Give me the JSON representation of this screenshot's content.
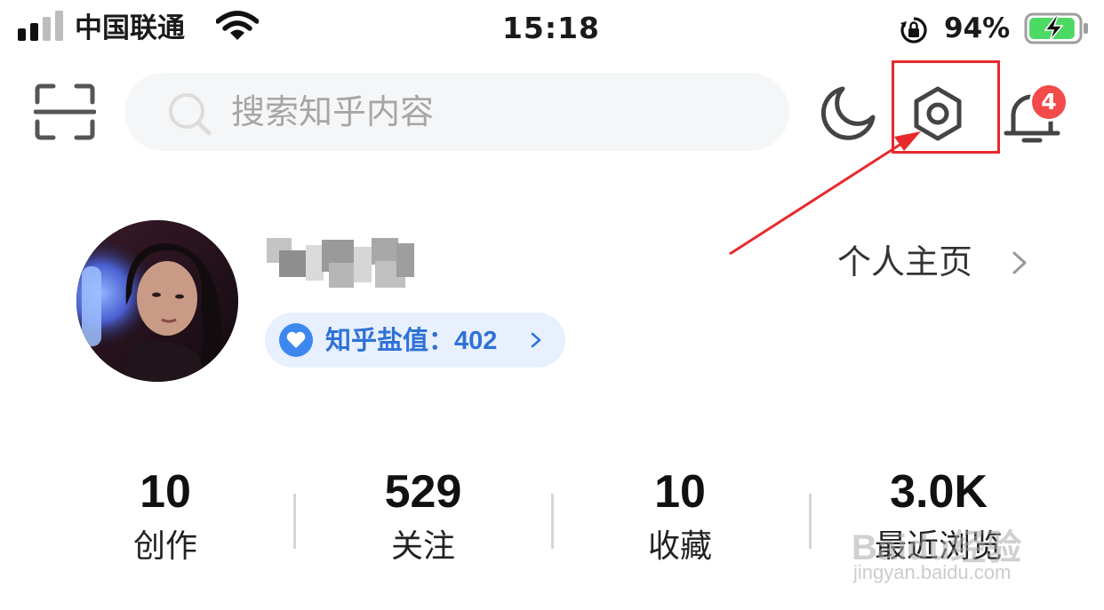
{
  "status_bar": {
    "carrier": "中国联通",
    "time": "15:18",
    "battery_percent": "94%",
    "battery_level": 0.94,
    "icons": [
      "signal-icon",
      "wifi-icon",
      "orientation-lock-icon",
      "battery-charging-icon"
    ]
  },
  "top_bar": {
    "search_placeholder": "搜索知乎内容",
    "icons": [
      "scan-icon",
      "search-icon",
      "night-mode-icon",
      "settings-icon",
      "bell-icon"
    ],
    "notification_count": "4",
    "highlight_color": "#e8292c"
  },
  "profile": {
    "salt_label": "知乎盐值：",
    "salt_value": "402",
    "homepage_label": "个人主页",
    "accent_color": "#2f72d6"
  },
  "stats": [
    {
      "value": "10",
      "label": "创作"
    },
    {
      "value": "529",
      "label": "关注"
    },
    {
      "value": "10",
      "label": "收藏"
    },
    {
      "value": "3.0K",
      "label": "最近浏览"
    }
  ],
  "watermark": {
    "text": "Baidu经验",
    "url": "jingyan.baidu.com"
  }
}
